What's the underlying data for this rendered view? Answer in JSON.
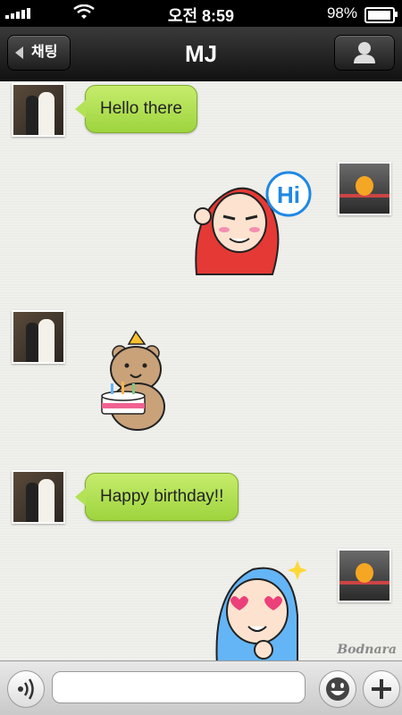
{
  "status_bar": {
    "time": "오전 8:59",
    "battery": "98%",
    "battery_level": 0.98
  },
  "nav": {
    "back_label": "채팅",
    "title": "MJ"
  },
  "messages": [
    {
      "sender": "MJ",
      "type": "text",
      "text": "Hello there"
    },
    {
      "sender": "me",
      "type": "sticker",
      "sticker": "hi-waving-red-hood",
      "text": "Hi"
    },
    {
      "sender": "MJ",
      "type": "sticker",
      "sticker": "bear-birthday-cake"
    },
    {
      "sender": "MJ",
      "type": "text",
      "text": "Happy birthday!!"
    },
    {
      "sender": "me",
      "type": "sticker",
      "sticker": "blue-hood-heart-eyes"
    }
  ],
  "input": {
    "placeholder": "",
    "value": ""
  },
  "watermark": "Bodnara",
  "colors": {
    "bubble": "#b3e257",
    "navbar": "#1a1a1a",
    "background": "#efefeb"
  }
}
